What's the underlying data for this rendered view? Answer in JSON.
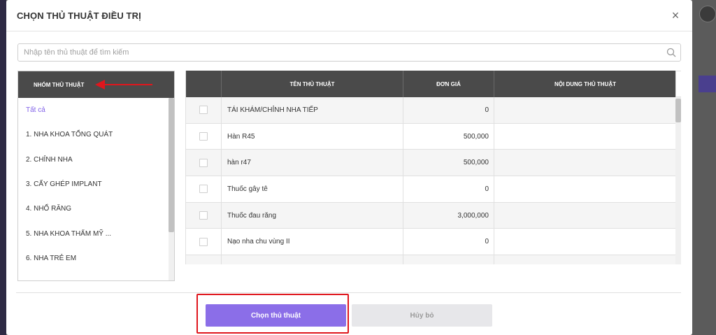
{
  "modal": {
    "title": "CHỌN THỦ THUẬT ĐIỀU TRỊ",
    "close_label": "×"
  },
  "search": {
    "placeholder": "Nhập tên thủ thuật để tìm kiếm",
    "value": ""
  },
  "groups": {
    "header": "NHÓM THỦ THUẬT",
    "items": [
      {
        "label": "Tất cả",
        "active": true
      },
      {
        "label": "1. NHA KHOA TỔNG QUÁT"
      },
      {
        "label": "2. CHỈNH NHA"
      },
      {
        "label": "3. CẤY GHÉP IMPLANT"
      },
      {
        "label": "4. NHỔ RĂNG"
      },
      {
        "label": "5. NHA KHOA THẨM MỸ ..."
      },
      {
        "label": "6. NHA TRẺ EM"
      }
    ]
  },
  "table": {
    "columns": [
      "",
      "TÊN THỦ THUẬT",
      "ĐƠN GIÁ",
      "NỘI DUNG THỦ THUẬT"
    ],
    "rows": [
      {
        "name": "TÁI KHÁM/CHỈNH NHA TIẾP",
        "price": "0",
        "desc": ""
      },
      {
        "name": "Hàn R45",
        "price": "500,000",
        "desc": ""
      },
      {
        "name": "hàn r47",
        "price": "500,000",
        "desc": ""
      },
      {
        "name": "Thuốc gây tê",
        "price": "0",
        "desc": ""
      },
      {
        "name": "Thuốc đau răng",
        "price": "3,000,000",
        "desc": ""
      },
      {
        "name": "Nạo nha chu vùng II",
        "price": "0",
        "desc": ""
      }
    ]
  },
  "footer": {
    "choose_label": "Chọn thủ thuật",
    "cancel_label": "Hủy bỏ"
  },
  "colors": {
    "accent": "#8b6ee8",
    "header_dark": "#4a4a4a",
    "annotation_red": "#e0161d"
  }
}
